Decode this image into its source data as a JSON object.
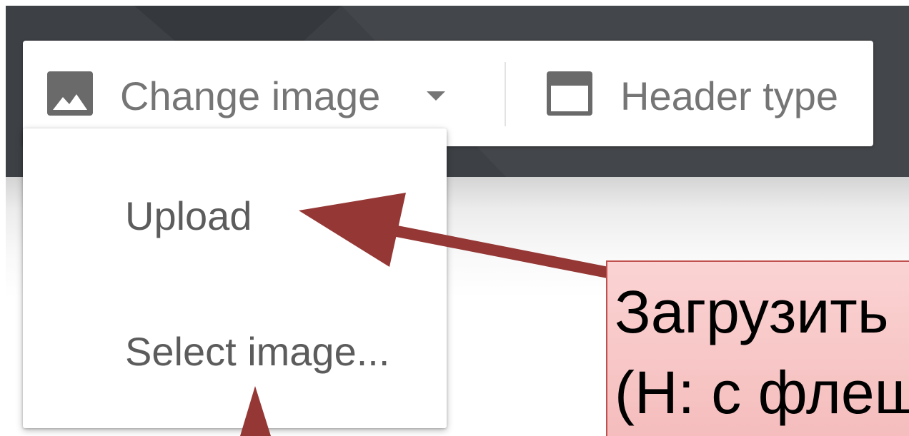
{
  "toolbar": {
    "change_image": {
      "label": "Change image",
      "icon": "image-icon",
      "dropdown_icon": "dropdown-arrow-icon"
    },
    "header_type": {
      "label": "Header type",
      "icon": "header-type-icon"
    }
  },
  "change_image_menu": {
    "items": [
      {
        "label": "Upload"
      },
      {
        "label": "Select image..."
      }
    ]
  },
  "annotation": {
    "lines": [
      "Загрузить",
      "(Н: с флеш"
    ]
  },
  "colors": {
    "header_background": "#3d4145",
    "annotation_fill": "#f7c4c4",
    "annotation_border": "#c0504d",
    "arrow": "#953735",
    "toolbar_text": "#757575",
    "menu_text": "#5c5c5c"
  }
}
